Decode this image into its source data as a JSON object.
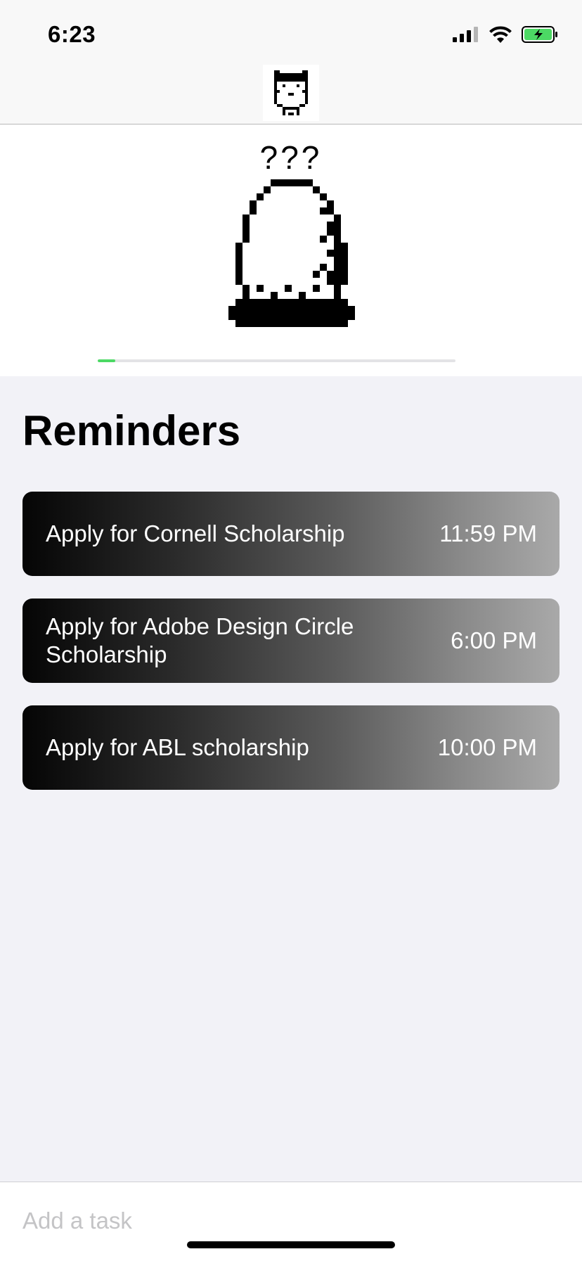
{
  "status": {
    "time": "6:23",
    "icons": [
      "signal-icon",
      "wifi-icon",
      "battery-charging-icon"
    ]
  },
  "nav": {
    "avatar_icon": "pixel-cat-icon"
  },
  "pet": {
    "name": "???",
    "image_icon": "pixel-egg-icon",
    "progress_percent": 5,
    "progress_color": "#4cd964"
  },
  "reminders": {
    "title": "Reminders",
    "items": [
      {
        "title": "Apply for Cornell Scholarship",
        "time": "11:59 PM"
      },
      {
        "title": "Apply for Adobe Design Circle Scholarship",
        "time": "6:00 PM"
      },
      {
        "title": "Apply for ABL scholarship",
        "time": "10:00 PM"
      }
    ]
  },
  "add_task": {
    "placeholder": "Add a task",
    "value": ""
  }
}
